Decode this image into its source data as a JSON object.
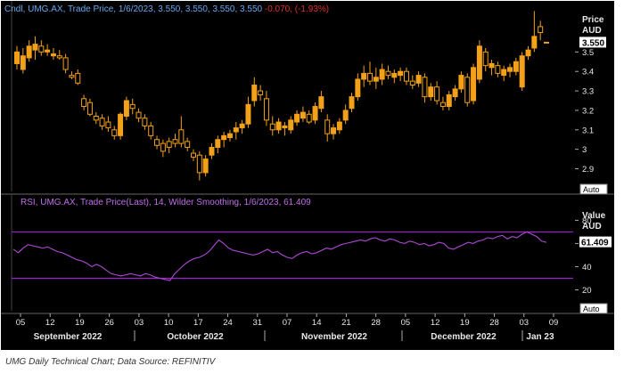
{
  "header": {
    "price_label": "Cndl, UMG.AX, Trade Price, 1/6/2023, 3.550, 3.550, 3.550, 3.550",
    "price_change": "-0.070, (-1.93%)",
    "rsi_label": "RSI, UMG.AX, Trade Price(Last), 14, Wilder Smoothing, 1/6/2023, 61.409"
  },
  "axes": {
    "price_unit_line1": "Price",
    "price_unit_line2": "AUD",
    "rsi_unit_line1": "Value",
    "rsi_unit_line2": "AUD",
    "auto_label": "Auto",
    "price_current": "3.550",
    "rsi_current": "61.409"
  },
  "caption": "UMG Daily Technical Chart; Data Source: REFINITIV",
  "colors": {
    "background": "#000000",
    "candle": "#f2a118",
    "rsi_line": "#b048d8",
    "band": "#a020d0",
    "label_blue": "#6aa8f0",
    "label_purple": "#c070e8",
    "change_red": "#e03030"
  },
  "chart_data": [
    {
      "type": "candlestick",
      "series": [
        {
          "name": "UMG.AX"
        }
      ],
      "yticks": [
        "3.5",
        "3.4",
        "3.3",
        "3.2",
        "3.1",
        "3",
        "2.9"
      ],
      "ylim": [
        2.82,
        3.68
      ],
      "current_value": 3.55,
      "candles": [
        {
          "o": 3.44,
          "h": 3.53,
          "l": 3.41,
          "c": 3.5
        },
        {
          "o": 3.41,
          "h": 3.52,
          "l": 3.39,
          "c": 3.48
        },
        {
          "o": 3.47,
          "h": 3.56,
          "l": 3.45,
          "c": 3.53
        },
        {
          "o": 3.51,
          "h": 3.58,
          "l": 3.46,
          "c": 3.54
        },
        {
          "o": 3.53,
          "h": 3.56,
          "l": 3.48,
          "c": 3.5
        },
        {
          "o": 3.5,
          "h": 3.54,
          "l": 3.48,
          "c": 3.51
        },
        {
          "o": 3.48,
          "h": 3.52,
          "l": 3.46,
          "c": 3.49
        },
        {
          "o": 3.48,
          "h": 3.51,
          "l": 3.46,
          "c": 3.47
        },
        {
          "o": 3.47,
          "h": 3.49,
          "l": 3.39,
          "c": 3.41
        },
        {
          "o": 3.38,
          "h": 3.4,
          "l": 3.36,
          "c": 3.37
        },
        {
          "o": 3.39,
          "h": 3.41,
          "l": 3.33,
          "c": 3.34
        },
        {
          "o": 3.26,
          "h": 3.28,
          "l": 3.2,
          "c": 3.22
        },
        {
          "o": 3.24,
          "h": 3.26,
          "l": 3.17,
          "c": 3.18
        },
        {
          "o": 3.17,
          "h": 3.19,
          "l": 3.13,
          "c": 3.15
        },
        {
          "o": 3.16,
          "h": 3.18,
          "l": 3.1,
          "c": 3.12
        },
        {
          "o": 3.14,
          "h": 3.17,
          "l": 3.09,
          "c": 3.11
        },
        {
          "o": 3.1,
          "h": 3.12,
          "l": 3.05,
          "c": 3.07
        },
        {
          "o": 3.07,
          "h": 3.19,
          "l": 3.05,
          "c": 3.18
        },
        {
          "o": 3.17,
          "h": 3.27,
          "l": 3.15,
          "c": 3.25
        },
        {
          "o": 3.23,
          "h": 3.26,
          "l": 3.18,
          "c": 3.21
        },
        {
          "o": 3.19,
          "h": 3.21,
          "l": 3.14,
          "c": 3.16
        },
        {
          "o": 3.16,
          "h": 3.18,
          "l": 3.1,
          "c": 3.12
        },
        {
          "o": 3.12,
          "h": 3.14,
          "l": 3.05,
          "c": 3.07
        },
        {
          "o": 3.05,
          "h": 3.07,
          "l": 3.0,
          "c": 3.02
        },
        {
          "o": 3.03,
          "h": 3.05,
          "l": 2.96,
          "c": 2.99
        },
        {
          "o": 3.04,
          "h": 3.06,
          "l": 2.98,
          "c": 3.01
        },
        {
          "o": 3.05,
          "h": 3.08,
          "l": 3.01,
          "c": 3.03
        },
        {
          "o": 3.1,
          "h": 3.17,
          "l": 3.01,
          "c": 3.03
        },
        {
          "o": 3.04,
          "h": 3.06,
          "l": 2.99,
          "c": 3.01
        },
        {
          "o": 2.98,
          "h": 3.0,
          "l": 2.94,
          "c": 2.96
        },
        {
          "o": 2.97,
          "h": 2.99,
          "l": 2.84,
          "c": 2.88
        },
        {
          "o": 2.88,
          "h": 2.97,
          "l": 2.86,
          "c": 2.95
        },
        {
          "o": 2.97,
          "h": 3.03,
          "l": 2.95,
          "c": 3.01
        },
        {
          "o": 3.01,
          "h": 3.07,
          "l": 2.98,
          "c": 3.05
        },
        {
          "o": 3.05,
          "h": 3.09,
          "l": 3.01,
          "c": 3.07
        },
        {
          "o": 3.06,
          "h": 3.1,
          "l": 3.04,
          "c": 3.08
        },
        {
          "o": 3.09,
          "h": 3.14,
          "l": 3.05,
          "c": 3.11
        },
        {
          "o": 3.11,
          "h": 3.15,
          "l": 3.08,
          "c": 3.13
        },
        {
          "o": 3.13,
          "h": 3.27,
          "l": 3.11,
          "c": 3.23
        },
        {
          "o": 3.25,
          "h": 3.37,
          "l": 3.22,
          "c": 3.33
        },
        {
          "o": 3.3,
          "h": 3.33,
          "l": 3.25,
          "c": 3.28
        },
        {
          "o": 3.26,
          "h": 3.3,
          "l": 3.12,
          "c": 3.15
        },
        {
          "o": 3.13,
          "h": 3.17,
          "l": 3.07,
          "c": 3.1
        },
        {
          "o": 3.1,
          "h": 3.16,
          "l": 3.08,
          "c": 3.14
        },
        {
          "o": 3.11,
          "h": 3.14,
          "l": 3.07,
          "c": 3.12
        },
        {
          "o": 3.1,
          "h": 3.17,
          "l": 3.08,
          "c": 3.15
        },
        {
          "o": 3.14,
          "h": 3.2,
          "l": 3.12,
          "c": 3.18
        },
        {
          "o": 3.16,
          "h": 3.22,
          "l": 3.14,
          "c": 3.19
        },
        {
          "o": 3.18,
          "h": 3.2,
          "l": 3.13,
          "c": 3.14
        },
        {
          "o": 3.15,
          "h": 3.24,
          "l": 3.13,
          "c": 3.22
        },
        {
          "o": 3.21,
          "h": 3.3,
          "l": 3.19,
          "c": 3.27
        },
        {
          "o": 3.15,
          "h": 3.18,
          "l": 3.04,
          "c": 3.08
        },
        {
          "o": 3.08,
          "h": 3.13,
          "l": 3.05,
          "c": 3.11
        },
        {
          "o": 3.1,
          "h": 3.16,
          "l": 3.08,
          "c": 3.14
        },
        {
          "o": 3.15,
          "h": 3.23,
          "l": 3.13,
          "c": 3.2
        },
        {
          "o": 3.21,
          "h": 3.29,
          "l": 3.19,
          "c": 3.27
        },
        {
          "o": 3.27,
          "h": 3.39,
          "l": 3.25,
          "c": 3.36
        },
        {
          "o": 3.36,
          "h": 3.43,
          "l": 3.32,
          "c": 3.39
        },
        {
          "o": 3.39,
          "h": 3.45,
          "l": 3.33,
          "c": 3.35
        },
        {
          "o": 3.35,
          "h": 3.42,
          "l": 3.31,
          "c": 3.37
        },
        {
          "o": 3.36,
          "h": 3.44,
          "l": 3.33,
          "c": 3.41
        },
        {
          "o": 3.4,
          "h": 3.43,
          "l": 3.36,
          "c": 3.38
        },
        {
          "o": 3.37,
          "h": 3.41,
          "l": 3.34,
          "c": 3.39
        },
        {
          "o": 3.38,
          "h": 3.42,
          "l": 3.35,
          "c": 3.4
        },
        {
          "o": 3.4,
          "h": 3.42,
          "l": 3.33,
          "c": 3.35
        },
        {
          "o": 3.35,
          "h": 3.38,
          "l": 3.31,
          "c": 3.33
        },
        {
          "o": 3.34,
          "h": 3.4,
          "l": 3.32,
          "c": 3.38
        },
        {
          "o": 3.37,
          "h": 3.39,
          "l": 3.24,
          "c": 3.27
        },
        {
          "o": 3.27,
          "h": 3.34,
          "l": 3.25,
          "c": 3.32
        },
        {
          "o": 3.32,
          "h": 3.35,
          "l": 3.23,
          "c": 3.25
        },
        {
          "o": 3.24,
          "h": 3.27,
          "l": 3.2,
          "c": 3.22
        },
        {
          "o": 3.22,
          "h": 3.3,
          "l": 3.2,
          "c": 3.28
        },
        {
          "o": 3.27,
          "h": 3.33,
          "l": 3.25,
          "c": 3.31
        },
        {
          "o": 3.31,
          "h": 3.4,
          "l": 3.29,
          "c": 3.38
        },
        {
          "o": 3.37,
          "h": 3.39,
          "l": 3.22,
          "c": 3.24
        },
        {
          "o": 3.25,
          "h": 3.44,
          "l": 3.23,
          "c": 3.42
        },
        {
          "o": 3.36,
          "h": 3.56,
          "l": 3.34,
          "c": 3.53
        },
        {
          "o": 3.5,
          "h": 3.52,
          "l": 3.4,
          "c": 3.43
        },
        {
          "o": 3.42,
          "h": 3.46,
          "l": 3.38,
          "c": 3.44
        },
        {
          "o": 3.43,
          "h": 3.45,
          "l": 3.37,
          "c": 3.39
        },
        {
          "o": 3.38,
          "h": 3.43,
          "l": 3.35,
          "c": 3.41
        },
        {
          "o": 3.4,
          "h": 3.44,
          "l": 3.37,
          "c": 3.42
        },
        {
          "o": 3.4,
          "h": 3.47,
          "l": 3.38,
          "c": 3.45
        },
        {
          "o": 3.32,
          "h": 3.5,
          "l": 3.3,
          "c": 3.48
        },
        {
          "o": 3.48,
          "h": 3.53,
          "l": 3.46,
          "c": 3.51
        },
        {
          "o": 3.52,
          "h": 3.71,
          "l": 3.5,
          "c": 3.58
        },
        {
          "o": 3.63,
          "h": 3.66,
          "l": 3.56,
          "c": 3.6
        },
        {
          "o": 3.55,
          "h": 3.55,
          "l": 3.55,
          "c": 3.55
        }
      ]
    },
    {
      "type": "line",
      "series": [
        {
          "name": "RSI"
        }
      ],
      "yticks": [
        "80",
        "60",
        "40",
        "20"
      ],
      "ylim": [
        5,
        88
      ],
      "bands": [
        70,
        30
      ],
      "current_value": 61.409,
      "values": [
        55,
        52,
        56,
        59,
        58,
        57,
        56,
        57,
        55,
        53,
        52,
        50,
        48,
        46,
        45,
        43,
        40,
        42,
        40,
        37,
        34,
        33,
        32,
        33,
        34,
        33,
        32,
        34,
        33,
        31,
        30,
        29,
        28,
        34,
        38,
        42,
        45,
        47,
        48,
        50,
        53,
        58,
        63,
        60,
        56,
        54,
        53,
        52,
        51,
        50,
        51,
        53,
        55,
        52,
        53,
        50,
        48,
        47,
        50,
        52,
        53,
        51,
        52,
        54,
        56,
        55,
        57,
        59,
        60,
        61,
        62,
        63,
        62,
        64,
        65,
        63,
        62,
        64,
        63,
        61,
        60,
        62,
        61,
        59,
        60,
        58,
        59,
        61,
        60,
        56,
        55,
        57,
        59,
        61,
        60,
        62,
        63,
        65,
        64,
        66,
        67,
        64,
        66,
        65,
        68,
        70,
        68,
        66,
        62,
        61
      ]
    }
  ],
  "x_axis": {
    "day_ticks": [
      "05",
      "12",
      "19",
      "26",
      "03",
      "10",
      "17",
      "24",
      "31",
      "07",
      "14",
      "21",
      "28",
      "05",
      "12",
      "19",
      "28",
      "03",
      "09"
    ],
    "month_labels": [
      "September 2022",
      "October 2022",
      "November 2022",
      "December 2022",
      "Jan 23"
    ]
  }
}
